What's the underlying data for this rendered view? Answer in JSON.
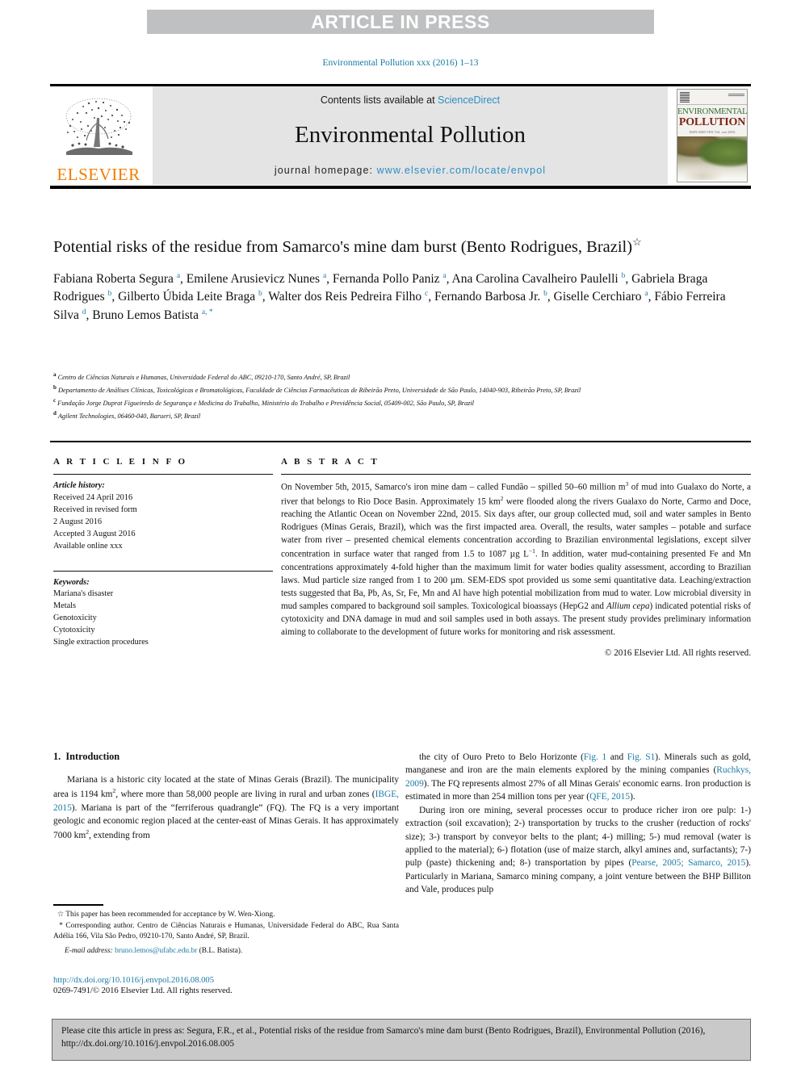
{
  "banner": {
    "label": "ARTICLE IN PRESS"
  },
  "journal_ref": "Environmental Pollution xxx (2016) 1–13",
  "masthead": {
    "contents_prefix": "Contents lists available at ",
    "contents_link": "ScienceDirect",
    "journal_title": "Environmental Pollution",
    "homepage_prefix": "journal homepage: ",
    "homepage_link": "www.elsevier.com/locate/envpol",
    "publisher": "ELSEVIER",
    "cover": {
      "line1": "ENVIRONMENTAL",
      "line2": "POLLUTION",
      "sub": "ISSN 0269-7491\nVol. xxx 2016"
    }
  },
  "article": {
    "title": "Potential risks of the residue from Samarco's mine dam burst (Bento Rodrigues, Brazil)",
    "title_marker": "☆",
    "authors": [
      {
        "name": "Fabiana Roberta Segura",
        "sup": "a"
      },
      {
        "name": "Emilene Arusievicz Nunes",
        "sup": "a"
      },
      {
        "name": "Fernanda Pollo Paniz",
        "sup": "a"
      },
      {
        "name": "Ana Carolina Cavalheiro Paulelli",
        "sup": "b"
      },
      {
        "name": "Gabriela Braga Rodrigues",
        "sup": "b"
      },
      {
        "name": "Gilberto Úbida Leite Braga",
        "sup": "b"
      },
      {
        "name": "Walter dos Reis Pedreira Filho",
        "sup": "c"
      },
      {
        "name": "Fernando Barbosa Jr.",
        "sup": "b"
      },
      {
        "name": "Giselle Cerchiaro",
        "sup": "a"
      },
      {
        "name": "Fábio Ferreira Silva",
        "sup": "d"
      },
      {
        "name": "Bruno Lemos Batista",
        "sup": "a, *"
      }
    ],
    "affiliations": [
      {
        "mark": "a",
        "text": "Centro de Ciências Naturais e Humanas, Universidade Federal do ABC, 09210-170, Santo André, SP, Brazil"
      },
      {
        "mark": "b",
        "text": "Departamento de Análises Clínicas, Toxicológicas e Bromatológicas, Faculdade de Ciências Farmacêuticas de Ribeirão Preto, Universidade de São Paulo, 14040-903, Ribeirão Preto, SP, Brazil"
      },
      {
        "mark": "c",
        "text": "Fundação Jorge Duprat Figueiredo de Segurança e Medicina do Trabalho, Ministério do Trabalho e Previdência Social, 05409-002, São Paulo, SP, Brazil"
      },
      {
        "mark": "d",
        "text": "Agilent Technologies, 06460-040, Barueri, SP, Brazil"
      }
    ]
  },
  "article_info": {
    "heading": "A R T I C L E   I N F O",
    "history_label": "Article history:",
    "history": [
      "Received 24 April 2016",
      "Received in revised form",
      "2 August 2016",
      "Accepted 3 August 2016",
      "Available online xxx"
    ],
    "keywords_label": "Keywords:",
    "keywords": [
      "Mariana's disaster",
      "Metals",
      "Genotoxicity",
      "Cytotoxicity",
      "Single extraction procedures"
    ]
  },
  "abstract": {
    "heading": "A B S T R A C T",
    "text_parts": [
      "On November 5th, 2015, Samarco's iron mine dam – called Fundão – spilled 50–60 million m",
      "3",
      " of mud into Gualaxo do Norte, a river that belongs to Rio Doce Basin. Approximately 15 km",
      "2",
      " were flooded along the rivers Gualaxo do Norte, Carmo and Doce, reaching the Atlantic Ocean on November 22nd, 2015. Six days after, our group collected mud, soil and water samples in Bento Rodrigues (Minas Gerais, Brazil), which was the first impacted area. Overall, the results, water samples – potable and surface water from river – presented chemical elements concentration according to Brazilian environmental legislations, except silver concentration in surface water that ranged from 1.5 to 1087 µg L",
      "−1",
      ". In addition, water mud-containing presented Fe and Mn concentrations approximately 4-fold higher than the maximum limit for water bodies quality assessment, according to Brazilian laws. Mud particle size ranged from 1 to 200 µm. SEM-EDS spot provided us some semi quantitative data. Leaching/extraction tests suggested that Ba, Pb, As, Sr, Fe, Mn and Al have high potential mobilization from mud to water. Low microbial diversity in mud samples compared to background soil samples. Toxicological bioassays (HepG2 and ",
      "Allium cepa",
      ") indicated potential risks of cytotoxicity and DNA damage in mud and soil samples used in both assays. The present study provides preliminary information aiming to collaborate to the development of future works for monitoring and risk assessment."
    ],
    "copyright": "© 2016 Elsevier Ltd. All rights reserved."
  },
  "introduction": {
    "section_number": "1.",
    "section_title": "Introduction",
    "left_paragraph_parts": [
      "Mariana is a historic city located at the state of Minas Gerais (Brazil). The municipality area is 1194 km",
      "2",
      ", where more than 58,000 people are living in rural and urban zones (",
      "IBGE, 2015",
      "). Mariana is part of the “ferriferous quadrangle” (FQ). The FQ is a very important geologic and economic region placed at the center-east of Minas Gerais. It has approximately 7000 km",
      "2",
      ", extending from"
    ],
    "right_paragraph1_parts": [
      "the city of Ouro Preto to Belo Horizonte (",
      "Fig. 1",
      " and ",
      "Fig. S1",
      "). Minerals such as gold, manganese and iron are the main elements explored by the mining companies (",
      "Ruchkys, 2009",
      "). The FQ represents almost 27% of all Minas Gerais' economic earns. Iron production is estimated in more than 254 million tons per year (",
      "QFE, 2015",
      ")."
    ],
    "right_paragraph2_parts": [
      "During iron ore mining, several processes occur to produce richer iron ore pulp: 1-) extraction (soil excavation); 2-) transportation by trucks to the crusher (reduction of rocks' size); 3-) transport by conveyor belts to the plant; 4-) milling; 5-) mud removal (water is applied to the material); 6-) flotation (use of maize starch, alkyl amines and, surfactants); 7-) pulp (paste) thickening and; 8-) transportation by pipes (",
      "Pearse, 2005; Samarco, 2015",
      "). Particularly in Mariana, Samarco mining company, a joint venture between the BHP Billiton and Vale, produces pulp"
    ]
  },
  "footnotes": {
    "star_marker": "☆",
    "star_text": "This paper has been recommended for acceptance by W. Wen-Xiong.",
    "corr_marker": "*",
    "corr_text": "Corresponding author. Centro de Ciências Naturais e Humanas, Universidade Federal do ABC, Rua Santa Adélia 166, Vila São Pedro, 09210-170, Santo André, SP, Brazil.",
    "email_label": "E-mail address:",
    "email": "bruno.lemos@ufabc.edu.br",
    "email_owner": "(B.L. Batista)."
  },
  "doi": {
    "url": "http://dx.doi.org/10.1016/j.envpol.2016.08.005",
    "issn_line": "0269-7491/© 2016 Elsevier Ltd. All rights reserved."
  },
  "citation_box": {
    "text": "Please cite this article in press as: Segura, F.R., et al., Potential risks of the residue from Samarco's mine dam burst (Bento Rodrigues, Brazil), Environmental Pollution (2016), http://dx.doi.org/10.1016/j.envpol.2016.08.005"
  },
  "colors": {
    "link": "#1a7ba5",
    "banner_bg": "#bfc0c1",
    "masthead_bg": "#e4e4e4",
    "elsevier_orange": "#f07d00",
    "citation_box_bg": "#c9c9c9"
  }
}
